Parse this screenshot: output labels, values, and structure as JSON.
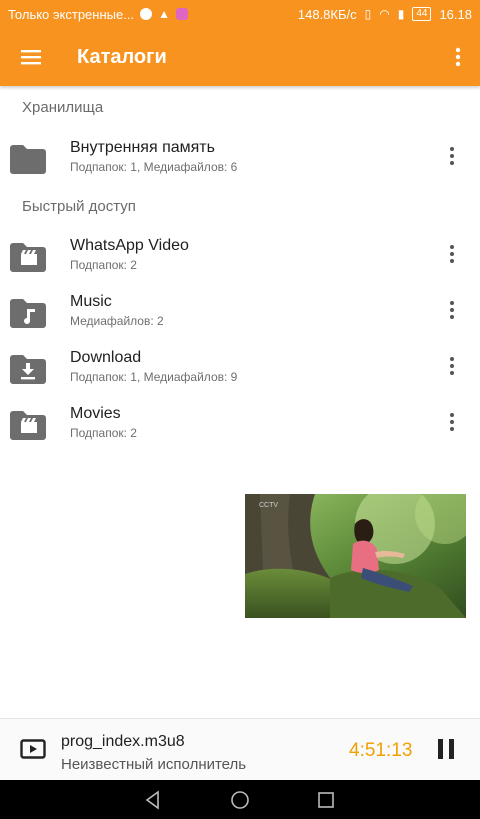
{
  "status_bar": {
    "carrier_text": "Только экстренные...",
    "network_speed": "148.8КБ/с",
    "battery": "44",
    "time": "16.18"
  },
  "toolbar": {
    "title": "Каталоги",
    "menu_icon": "hamburger-menu-icon",
    "overflow_icon": "more-vert-icon"
  },
  "sections": {
    "storage": {
      "header": "Хранилища",
      "items": [
        {
          "name": "Внутренняя память",
          "details": "Подпапок: 1, Медиафайлов: 6",
          "icon": "folder-icon"
        }
      ]
    },
    "quick_access": {
      "header": "Быстрый доступ",
      "items": [
        {
          "name": "WhatsApp Video",
          "details": "Подпапок: 2",
          "icon": "video-folder-icon"
        },
        {
          "name": "Music",
          "details": "Медиафайлов: 2",
          "icon": "music-folder-icon"
        },
        {
          "name": "Download",
          "details": "Подпапок: 1, Медиафайлов: 9",
          "icon": "download-folder-icon"
        },
        {
          "name": "Movies",
          "details": "Подпапок: 2",
          "icon": "video-folder-icon"
        }
      ]
    }
  },
  "player": {
    "title": "prog_index.m3u8",
    "artist": "Неизвестный исполнитель",
    "time": "4:51:13",
    "accent_color": "#f2a000"
  },
  "colors": {
    "primary": "#f7931e",
    "folder": "#6d6d6d"
  }
}
